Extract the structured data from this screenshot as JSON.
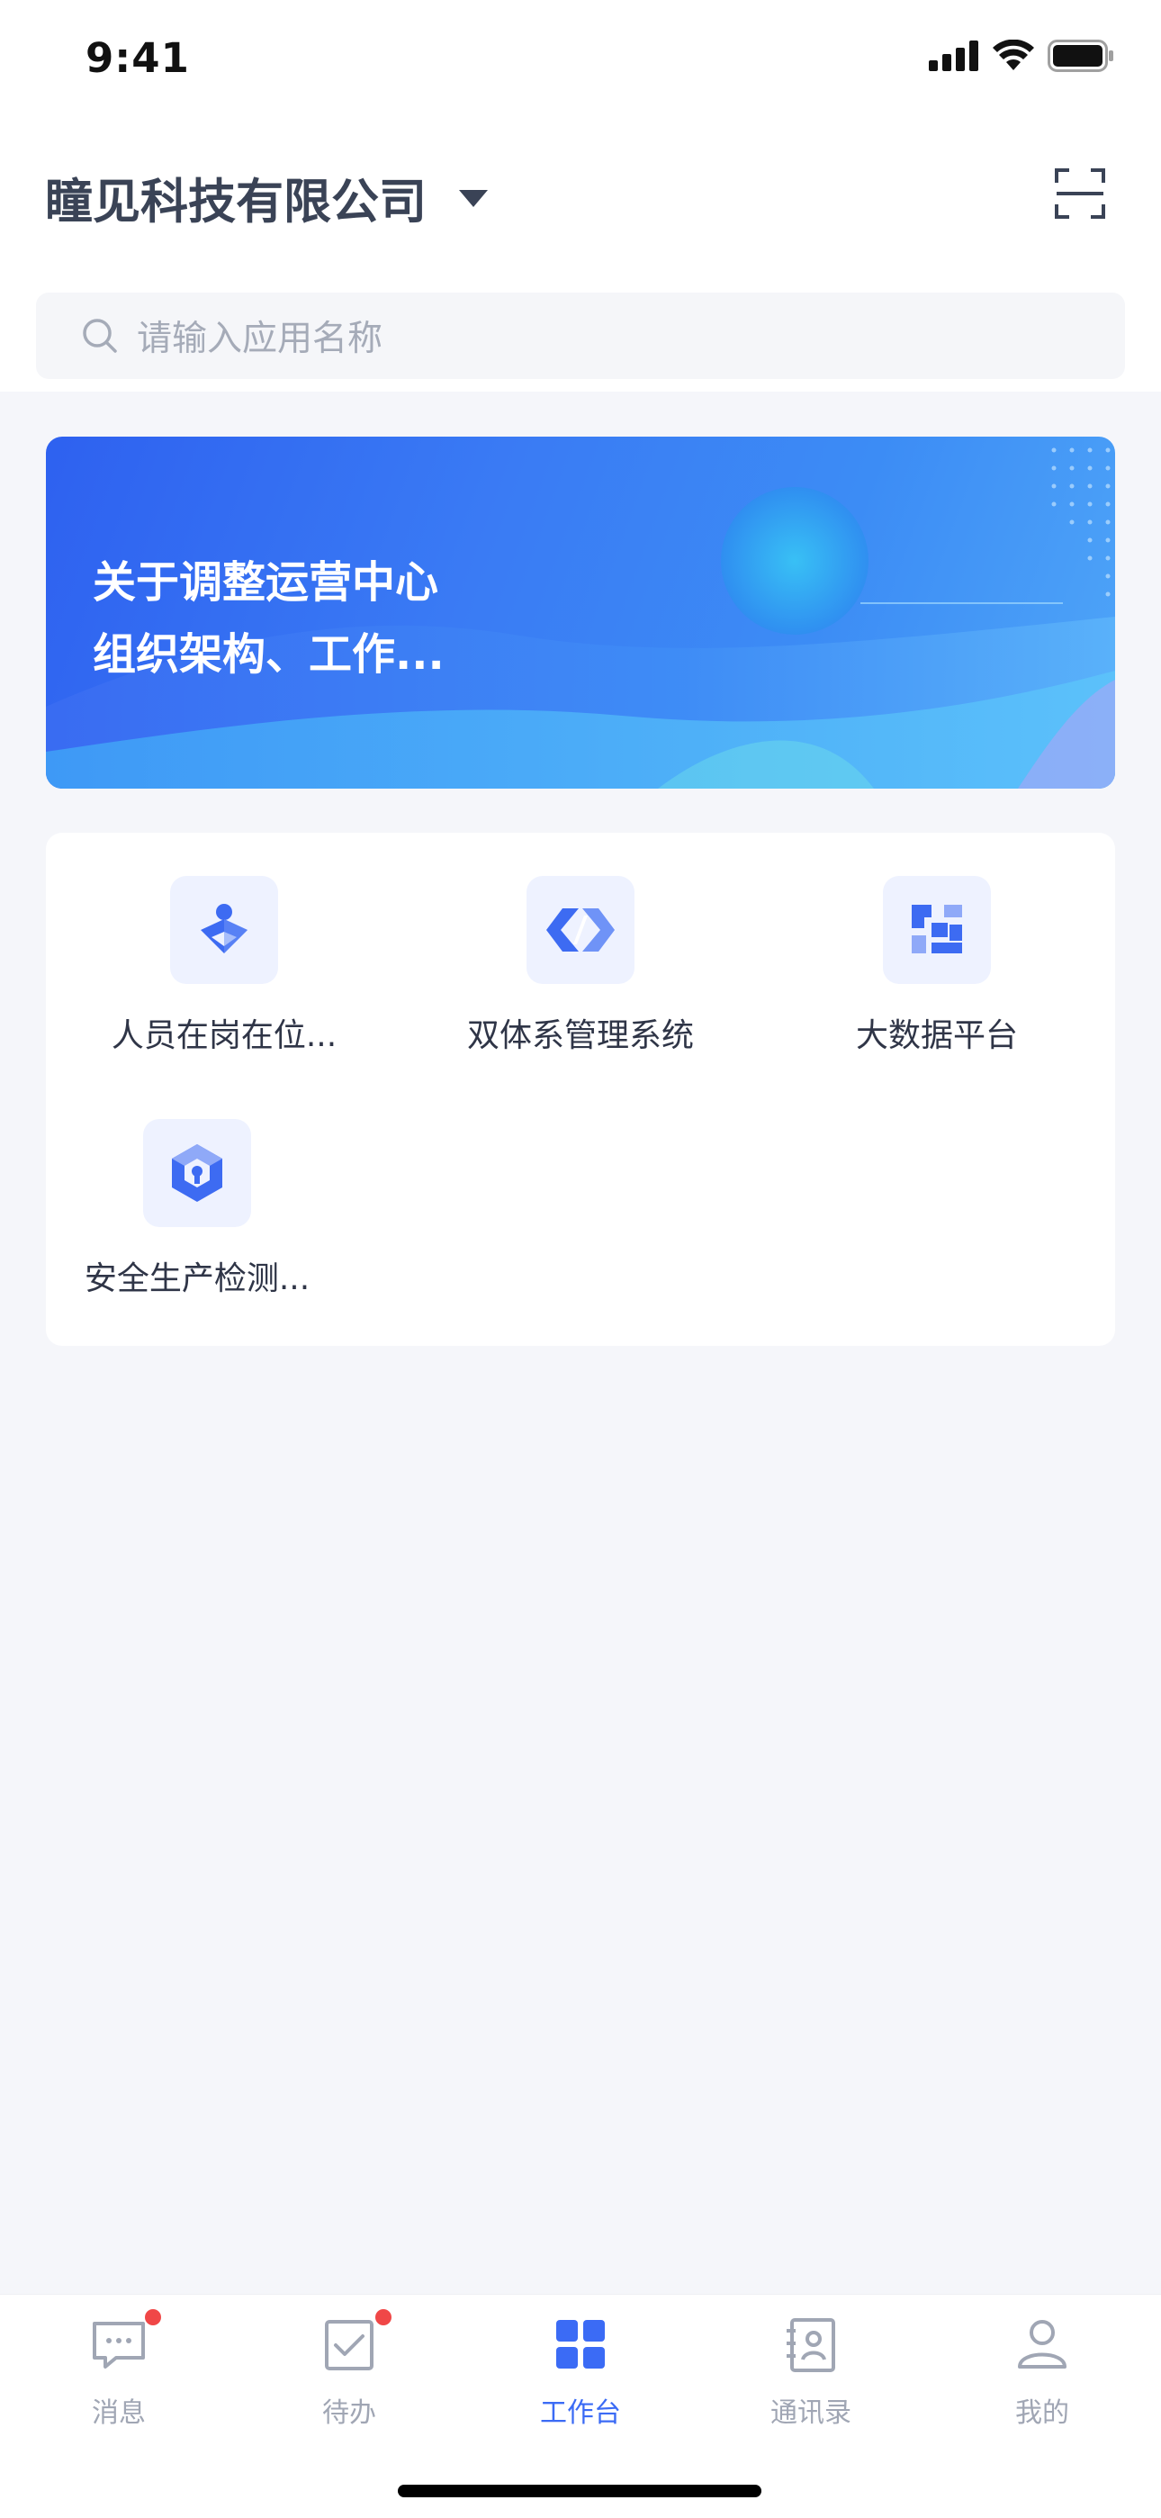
{
  "status_bar": {
    "time": "9:41"
  },
  "header": {
    "company_name": "瞳见科技有限公司"
  },
  "search": {
    "placeholder": "请输入应用名称"
  },
  "banner": {
    "title": "关于调整运营中心\n组织架构、工作..."
  },
  "apps": [
    {
      "label": "人员在岗在位...",
      "icon": "person-location-icon"
    },
    {
      "label": "双体系管理系统",
      "icon": "code-shield-icon"
    },
    {
      "label": "大数据平台",
      "icon": "data-blocks-icon"
    },
    {
      "label": "安全生产检测...",
      "icon": "hexagon-lock-icon"
    }
  ],
  "tabbar": {
    "items": [
      {
        "label": "消息",
        "icon": "message-icon",
        "badge": true,
        "active": false
      },
      {
        "label": "待办",
        "icon": "todo-check-icon",
        "badge": true,
        "active": false
      },
      {
        "label": "工作台",
        "icon": "workbench-grid-icon",
        "badge": false,
        "active": true
      },
      {
        "label": "通讯录",
        "icon": "contacts-book-icon",
        "badge": false,
        "active": false
      },
      {
        "label": "我的",
        "icon": "profile-icon",
        "badge": false,
        "active": false
      }
    ]
  },
  "colors": {
    "accent": "#3B6BF5",
    "badge": "#F04747",
    "inactive": "#A0A6B4"
  }
}
